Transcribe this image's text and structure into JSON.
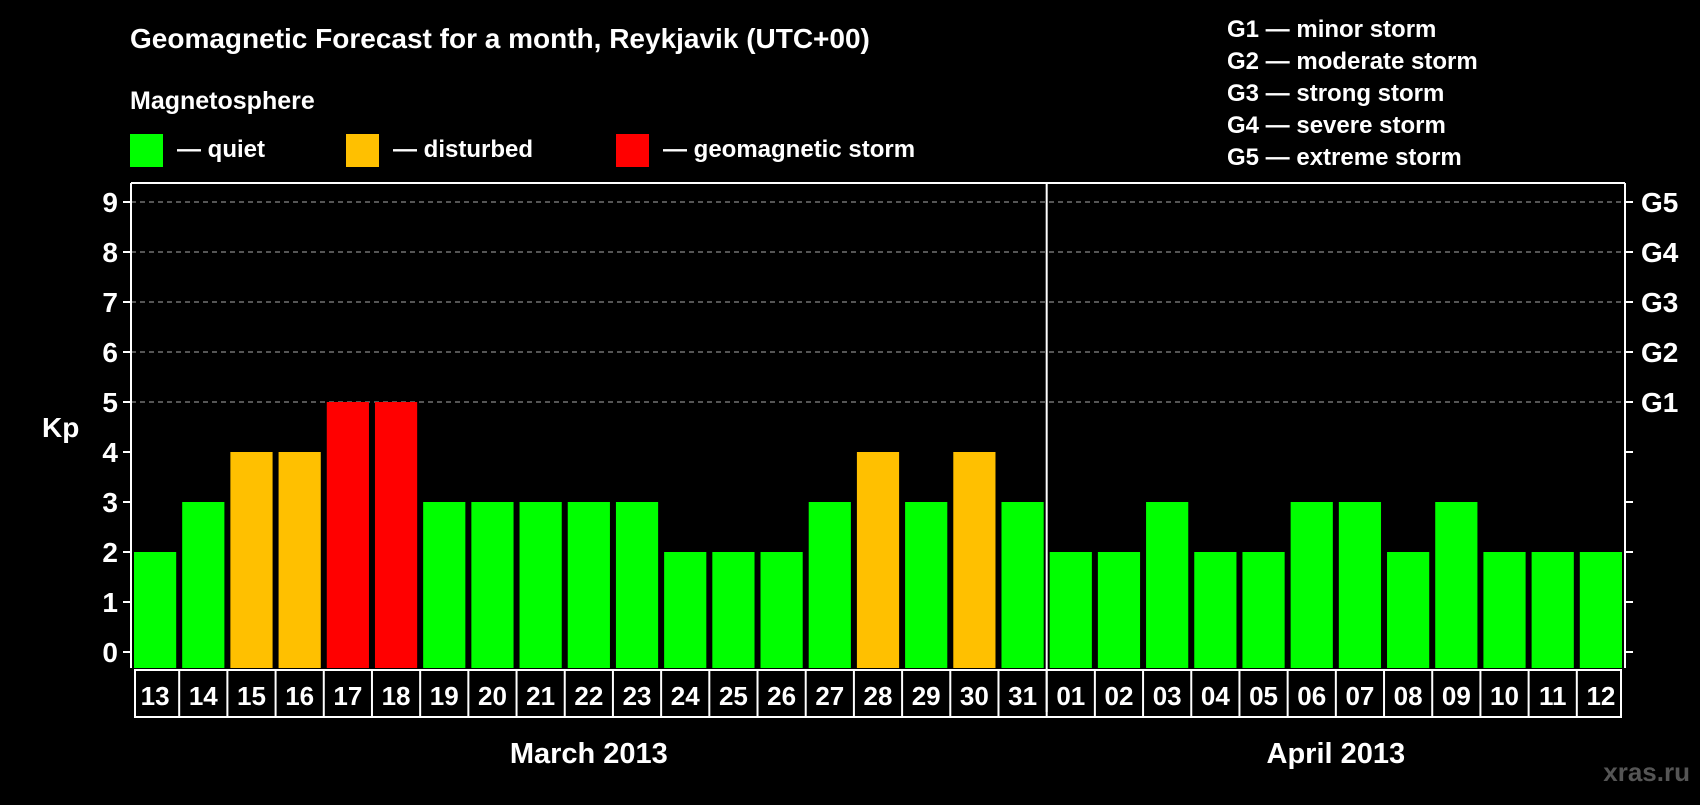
{
  "title": "Geomagnetic Forecast for a month, Reykjavik (UTC+00)",
  "legend": {
    "heading": "Magnetosphere",
    "items": [
      {
        "label": "— quiet",
        "color": "#00ff00"
      },
      {
        "label": "— disturbed",
        "color": "#ffc000"
      },
      {
        "label": "— geomagnetic storm",
        "color": "#ff0000"
      }
    ]
  },
  "storm_scale": [
    "G1 — minor storm",
    "G2 — moderate storm",
    "G3 — strong storm",
    "G4 — severe storm",
    "G5 — extreme storm"
  ],
  "watermark": "xras.ru",
  "colors": {
    "background": "#000000",
    "foreground": "#ffffff",
    "quiet": "#00ff00",
    "disturbed": "#ffc000",
    "storm": "#ff0000"
  },
  "chart_data": {
    "type": "bar",
    "ylabel": "Kp",
    "ylim": [
      0,
      9
    ],
    "y_ticks": [
      "0",
      "1",
      "2",
      "3",
      "4",
      "5",
      "6",
      "7",
      "8",
      "9"
    ],
    "right_axis_labels": [
      {
        "kp": 5,
        "label": "G1"
      },
      {
        "kp": 6,
        "label": "G2"
      },
      {
        "kp": 7,
        "label": "G3"
      },
      {
        "kp": 8,
        "label": "G4"
      },
      {
        "kp": 9,
        "label": "G5"
      }
    ],
    "grid": "dashed horizontal at Kp 5-9",
    "categories": [
      "13",
      "14",
      "15",
      "16",
      "17",
      "18",
      "19",
      "20",
      "21",
      "22",
      "23",
      "24",
      "25",
      "26",
      "27",
      "28",
      "29",
      "30",
      "31",
      "01",
      "02",
      "03",
      "04",
      "05",
      "06",
      "07",
      "08",
      "09",
      "10",
      "11",
      "12"
    ],
    "values": [
      2,
      3,
      4,
      4,
      5,
      5,
      3,
      3,
      3,
      3,
      3,
      2,
      2,
      2,
      3,
      4,
      3,
      4,
      3,
      2,
      2,
      3,
      2,
      2,
      3,
      3,
      2,
      3,
      2,
      2,
      2
    ],
    "levels": [
      "quiet",
      "quiet",
      "disturbed",
      "disturbed",
      "storm",
      "storm",
      "quiet",
      "quiet",
      "quiet",
      "quiet",
      "quiet",
      "quiet",
      "quiet",
      "quiet",
      "quiet",
      "disturbed",
      "quiet",
      "disturbed",
      "quiet",
      "quiet",
      "quiet",
      "quiet",
      "quiet",
      "quiet",
      "quiet",
      "quiet",
      "quiet",
      "quiet",
      "quiet",
      "quiet",
      "quiet"
    ],
    "month_groups": [
      {
        "label": "March 2013",
        "count": 19
      },
      {
        "label": "April 2013",
        "count": 12
      }
    ]
  }
}
